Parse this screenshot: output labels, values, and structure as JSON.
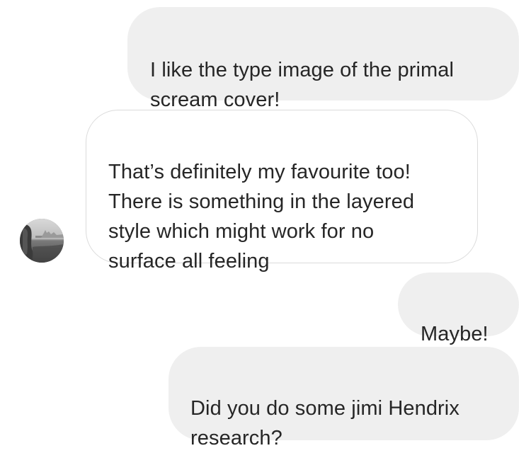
{
  "messages": [
    {
      "sender": "me",
      "text": "I like the type image of the primal\nscream cover!"
    },
    {
      "sender": "other",
      "text": "That’s definitely my favourite too!\nThere is something in the layered\nstyle which might work for no\nsurface all feeling"
    },
    {
      "sender": "me",
      "text": "Maybe!"
    },
    {
      "sender": "me",
      "text": "Did you do some jimi Hendrix\nresearch?"
    }
  ],
  "avatar": {
    "icon": "user-avatar-photo"
  },
  "colors": {
    "outgoing_bubble": "#efefef",
    "incoming_border": "#dbdbdb",
    "text": "#262626"
  }
}
